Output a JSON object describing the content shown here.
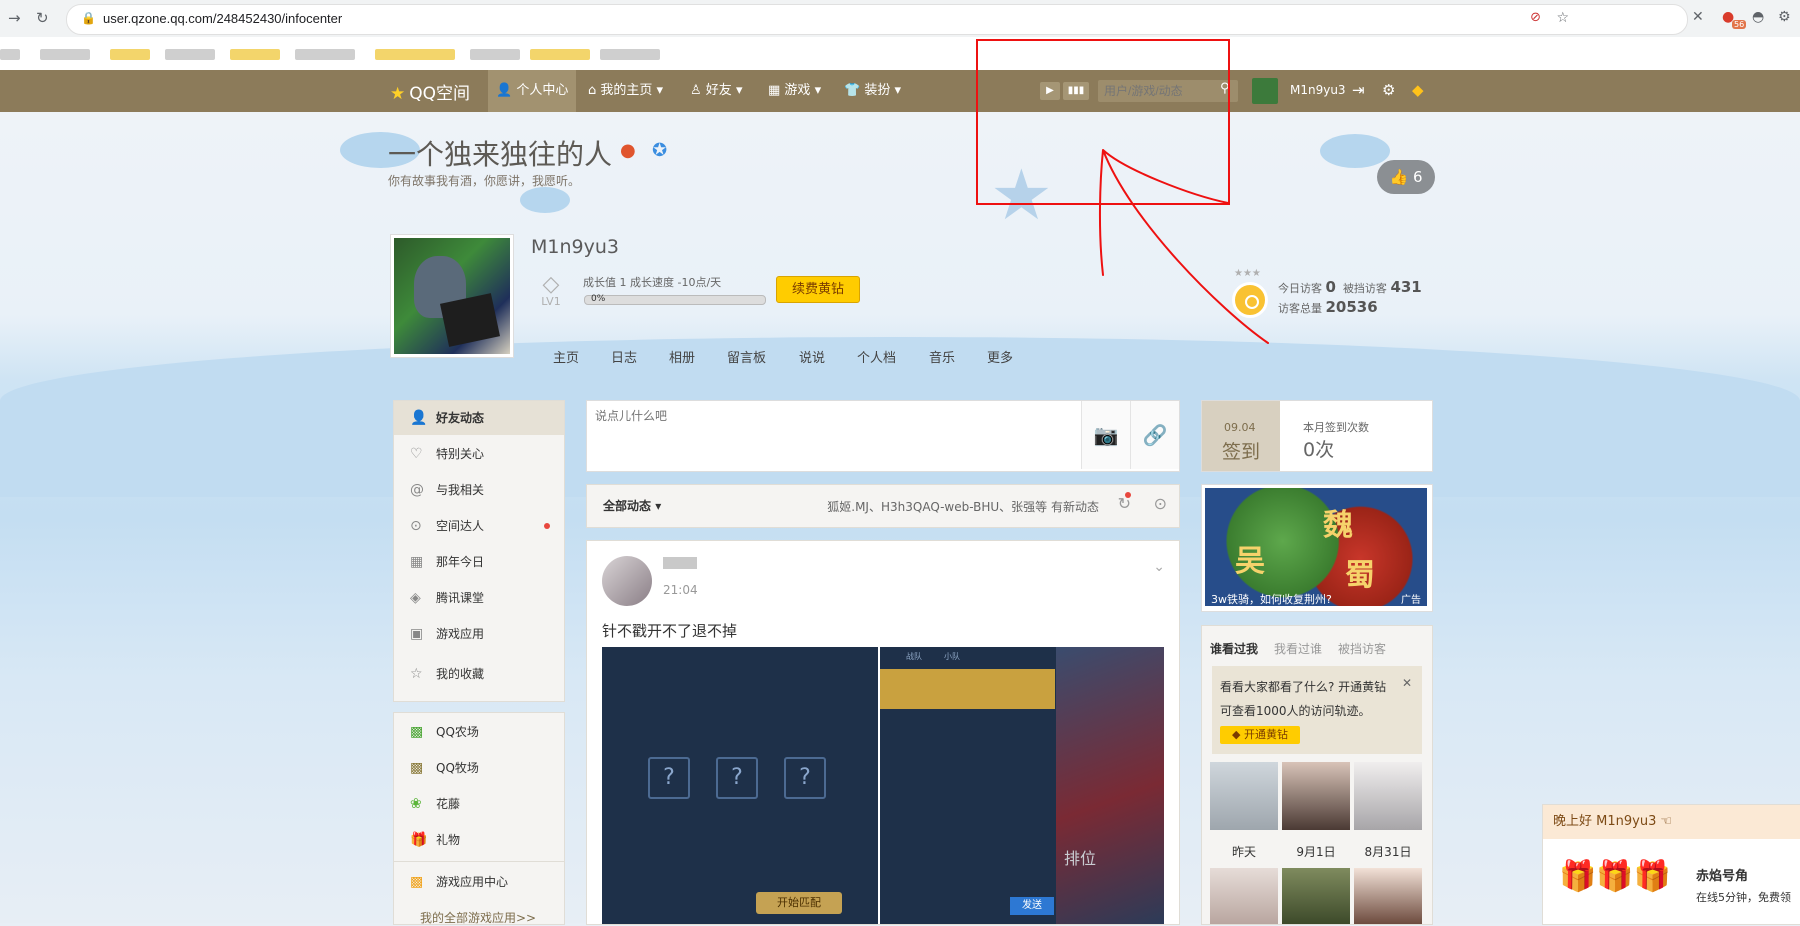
{
  "browser": {
    "url": "user.qzone.qq.com/248452430/infocenter",
    "ext_badge": "56"
  },
  "topnav": {
    "logo": "QQ空间",
    "items": [
      "个人中心",
      "我的主页",
      "好友",
      "游戏",
      "装扮"
    ],
    "search_placeholder": "用户/游戏/动态",
    "username": "M1n9yu3"
  },
  "header": {
    "title": "一个独来独往的人",
    "subtitle": "你有故事我有酒，你愿讲，我愿听。",
    "likes": "6"
  },
  "profile": {
    "name": "M1n9yu3",
    "level": "LV1",
    "growth": "成长值 1   成长速度 -10点/天",
    "progress_pct": "0%",
    "vip_button": "续费黄钻",
    "tabs": [
      "主页",
      "日志",
      "相册",
      "留言板",
      "说说",
      "个人档",
      "音乐",
      "更多"
    ],
    "visits": {
      "today_label": "今日访客",
      "today": "0",
      "blocked_label": "被挡访客",
      "blocked": "431",
      "total_label": "访客总量",
      "total": "20536"
    }
  },
  "left_menu": [
    {
      "label": "好友动态",
      "icon": "friends-icon",
      "glyph": "👤"
    },
    {
      "label": "特别关心",
      "icon": "heart-icon",
      "glyph": "♡"
    },
    {
      "label": "与我相关",
      "icon": "at-icon",
      "glyph": "@"
    },
    {
      "label": "空间达人",
      "icon": "play-circle-icon",
      "glyph": "⊙"
    },
    {
      "label": "那年今日",
      "icon": "calendar-icon",
      "glyph": "▦"
    },
    {
      "label": "腾讯课堂",
      "icon": "classroom-icon",
      "glyph": "◈"
    },
    {
      "label": "游戏应用",
      "icon": "grid-icon",
      "glyph": "▣"
    },
    {
      "label": "我的收藏",
      "icon": "star-icon",
      "glyph": "☆"
    }
  ],
  "apps_menu": [
    {
      "label": "QQ农场",
      "glyph": "▩"
    },
    {
      "label": "QQ牧场",
      "glyph": "▩"
    },
    {
      "label": "花藤",
      "glyph": "❀"
    },
    {
      "label": "礼物",
      "glyph": "🎁"
    },
    {
      "label": "游戏应用中心",
      "glyph": "▩"
    }
  ],
  "apps_all": "我的全部游戏应用>>",
  "composer": {
    "placeholder": "说点儿什么吧"
  },
  "feed_bar": {
    "filter": "全部动态",
    "news": "狐姬.MJ、H3h3QAQ-web-BHU、张强等 有新动态"
  },
  "post": {
    "time": "21:04",
    "text": "针不戳开不了退不掉",
    "game_button": "开始匹配",
    "send": "发送",
    "tabs": [
      "战队",
      "小队"
    ],
    "side_text": "排位"
  },
  "sign": {
    "date": "09.04",
    "button": "签到",
    "count_label": "本月签到次数",
    "count": "0次"
  },
  "ad": {
    "caption": "3w铁骑，如何收复荆州?",
    "tag": "广告",
    "k1": "魏",
    "k2": "吴",
    "k3": "蜀"
  },
  "visitors": {
    "tabs": [
      "谁看过我",
      "我看过谁",
      "被挡访客"
    ],
    "tip_line1": "看看大家都看了什么? 开通黄钻",
    "tip_line2": "可查看1000人的访问轨迹。",
    "tip_button": "开通黄钻",
    "dates": [
      "昨天",
      "9月1日",
      "8月31日"
    ]
  },
  "greeting": {
    "header": "晚上好 M1n9yu3",
    "title": "赤焰号角",
    "desc": "在线5分钟，免费领"
  }
}
